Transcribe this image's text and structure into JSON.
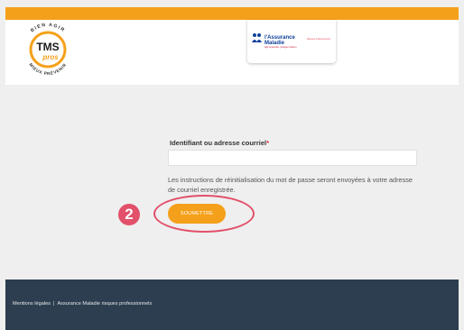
{
  "header": {
    "logo": {
      "ring_text_top": "BIEN AGIR",
      "ring_text_bottom": "MIEUX PRÉVENIR",
      "main_text": "TMS",
      "sub_text": "pros"
    },
    "partner": {
      "brand_line1": "l'Assurance",
      "brand_line2": "Maladie",
      "brand_tagline": "Agir ensemble, protéger chacun",
      "side_text": "Risques professionnels"
    }
  },
  "form": {
    "field_label": "Identifiant ou adresse courriel",
    "required_mark": "*",
    "input_value": "",
    "help_text": "Les instructions de réinitialisation du mot de passe seront envoyées à votre adresse de courriel enregistrée.",
    "submit_label": "SOUMETTRE"
  },
  "annotation": {
    "step_number": "2"
  },
  "footer": {
    "link_legal": "Mentions légales",
    "separator": "|",
    "link_am": "Assurance Maladie risques professionnels"
  },
  "colors": {
    "accent": "#f5a01a",
    "footer_bg": "#2c3e50",
    "annotation": "#e2506a",
    "brand_blue": "#0c419a"
  }
}
